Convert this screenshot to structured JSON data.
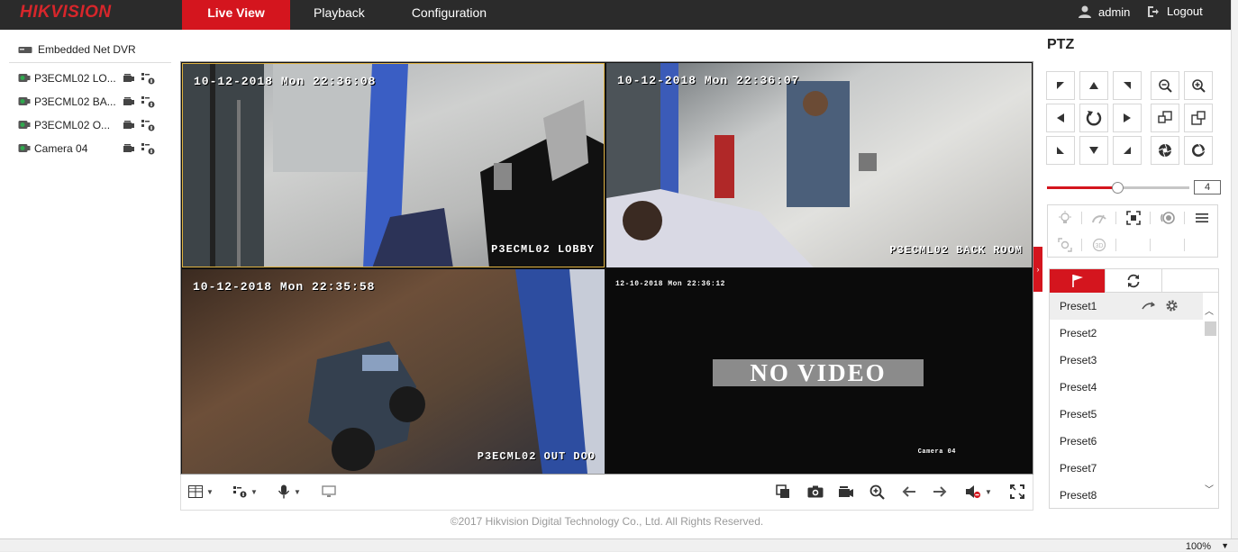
{
  "brand": {
    "logo": "HIKVISION",
    "accent": "#d4151e"
  },
  "nav": {
    "tabs": [
      {
        "label": "Live View",
        "active": true
      },
      {
        "label": "Playback",
        "active": false
      },
      {
        "label": "Configuration",
        "active": false
      }
    ],
    "user": "admin",
    "logout": "Logout"
  },
  "tree": {
    "root": "Embedded Net DVR",
    "cameras": [
      {
        "label": "P3ECML02 LO...",
        "icon": "camera-online-icon"
      },
      {
        "label": "P3ECML02 BA...",
        "icon": "camera-online-icon"
      },
      {
        "label": "P3ECML02 O...",
        "icon": "camera-online-icon"
      },
      {
        "label": "Camera 04",
        "icon": "camera-online-icon"
      }
    ]
  },
  "video": {
    "cells": [
      {
        "time": "10-12-2018 Mon 22:36:08",
        "name": "P3ECML02 LOBBY"
      },
      {
        "time": "10-12-2018 Mon 22:36:07",
        "name": "P3ECML02 BACK ROOM"
      },
      {
        "time": "10-12-2018 Mon 22:35:58",
        "name": "P3ECML02 OUT DOO"
      },
      {
        "time": "12-10-2018 Mon 22:36:12",
        "name": "Camera 04",
        "status": "NO VIDEO"
      }
    ]
  },
  "footer": {
    "copyright": "©2017 Hikvision Digital Technology Co., Ltd. All Rights Reserved."
  },
  "ptz": {
    "title": "PTZ",
    "speed": "4",
    "speed_level": 0.5,
    "tabs": [
      "preset-flag-icon",
      "patrol-icon",
      "pattern-icon"
    ],
    "presets": [
      "Preset1",
      "Preset2",
      "Preset3",
      "Preset4",
      "Preset5",
      "Preset6",
      "Preset7",
      "Preset8"
    ]
  },
  "statusbar": {
    "zoom": "100%"
  }
}
